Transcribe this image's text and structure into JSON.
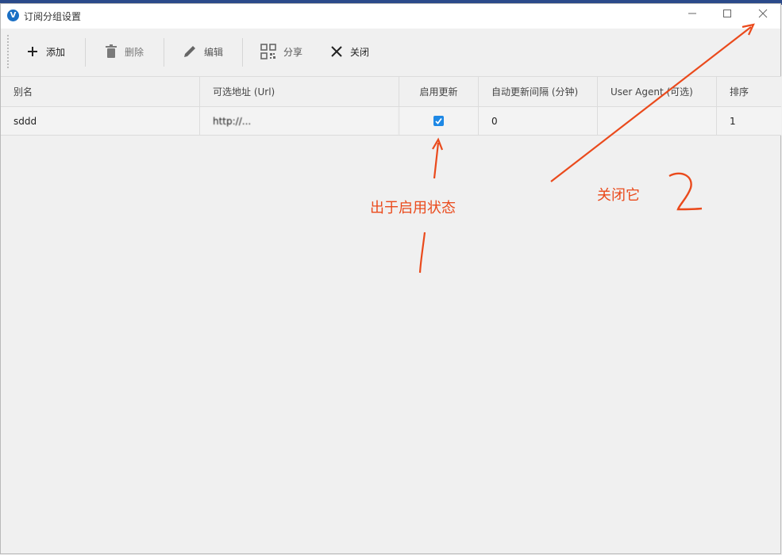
{
  "window": {
    "title": "订阅分组设置",
    "controls": {
      "minimize": "—",
      "maximize": "☐",
      "close": "✕"
    }
  },
  "toolbar": {
    "add_label": "添加",
    "delete_label": "删除",
    "edit_label": "编辑",
    "share_label": "分享",
    "close_label": "关闭"
  },
  "table": {
    "columns": [
      "别名",
      "可选地址 (Url)",
      "启用更新",
      "自动更新间隔 (分钟)",
      "User Agent (可选)",
      "排序"
    ],
    "rows": [
      {
        "alias": "sddd",
        "url": "http://...",
        "enabled": true,
        "interval": "0",
        "user_agent": "",
        "sort": "1"
      }
    ]
  },
  "annotations": {
    "label_1": "出于启用状态",
    "label_2": "关闭它",
    "mark_1": "1",
    "mark_2": "2"
  },
  "colors": {
    "annotation": "#ea4a1c",
    "checkbox": "#1e88e5"
  }
}
